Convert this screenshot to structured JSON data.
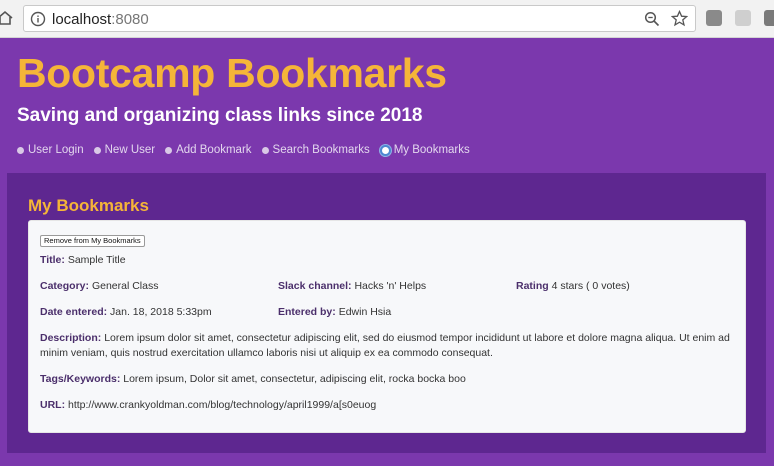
{
  "browser": {
    "url_host": "localhost",
    "url_port": ":8080"
  },
  "header": {
    "title": "Bootcamp Bookmarks",
    "subtitle": "Saving and organizing class links since 2018"
  },
  "nav": {
    "items": [
      {
        "label": "User Login",
        "active": false
      },
      {
        "label": "New User",
        "active": false
      },
      {
        "label": "Add Bookmark",
        "active": false
      },
      {
        "label": "Search Bookmarks",
        "active": false
      },
      {
        "label": "My Bookmarks",
        "active": true
      }
    ]
  },
  "main": {
    "section_title": "My Bookmarks",
    "bookmark": {
      "remove_label": "Remove from My Bookmarks",
      "title_label": "Title:",
      "title_value": "Sample Title",
      "category_label": "Category:",
      "category_value": "General Class",
      "slack_label": "Slack channel:",
      "slack_value": "Hacks 'n' Helps",
      "rating_label": "Rating",
      "rating_value": "4 stars ( 0 votes)",
      "date_label": "Date entered:",
      "date_value": "Jan. 18, 2018 5:33pm",
      "entered_label": "Entered by:",
      "entered_value": "Edwin Hsia",
      "desc_label": "Description:",
      "desc_value": "Lorem ipsum dolor sit amet, consectetur adipiscing elit, sed do eiusmod tempor incididunt ut labore et dolore magna aliqua. Ut enim ad minim veniam, quis nostrud exercitation ullamco laboris nisi ut aliquip ex ea commodo consequat.",
      "tags_label": "Tags/Keywords:",
      "tags_value": "Lorem ipsum, Dolor sit amet, consectetur, adipiscing elit, rocka bocka boo",
      "url_label": "URL:",
      "url_value": "http://www.crankyoldman.com/blog/technology/april1999/a[s0euog"
    }
  },
  "colors": {
    "background": "#7b38ad",
    "panel": "#5e2790",
    "accent": "#f5b538"
  }
}
